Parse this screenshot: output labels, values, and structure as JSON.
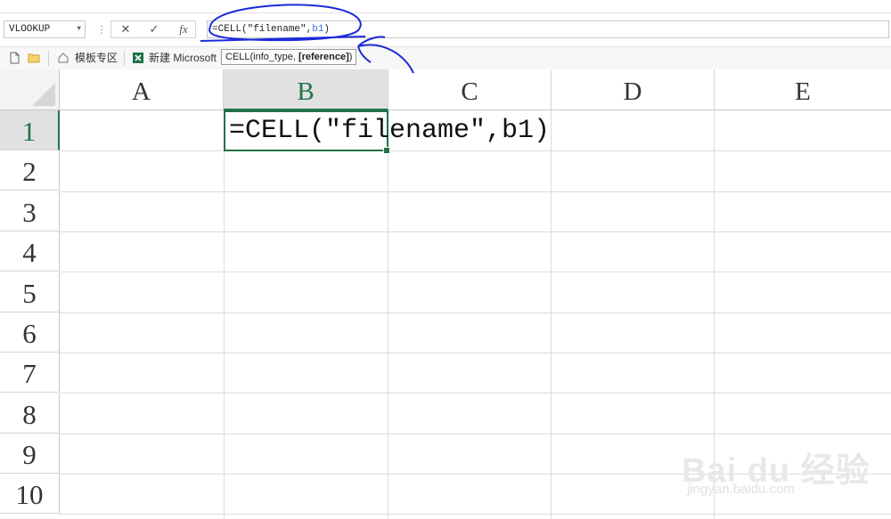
{
  "formula_bar": {
    "name_box": "VLOOKUP",
    "cancel_icon": "✕",
    "enter_icon": "✓",
    "fx_label": "fx",
    "formula_main": "=CELL(\"filename\",",
    "formula_ref": "b1",
    "formula_tail": ")"
  },
  "bookmarks": {
    "item1": "模板专区",
    "item2": "新建 Microsoft"
  },
  "tooltip": {
    "text": "CELL(info_type, ",
    "bold": "[reference]",
    "close": ")"
  },
  "columns": [
    "A",
    "B",
    "C",
    "D",
    "E"
  ],
  "rows": [
    "1",
    "2",
    "3",
    "4",
    "5",
    "6",
    "7",
    "8",
    "9",
    "10"
  ],
  "active_cell": {
    "address": "B1",
    "content": "=CELL(\"filename\",b1)"
  },
  "colors": {
    "excel_green": "#217346",
    "annotation_blue": "#1a2ad8"
  },
  "watermark": {
    "brand": "Bai du 经验",
    "url": "jingyan.baidu.com"
  }
}
